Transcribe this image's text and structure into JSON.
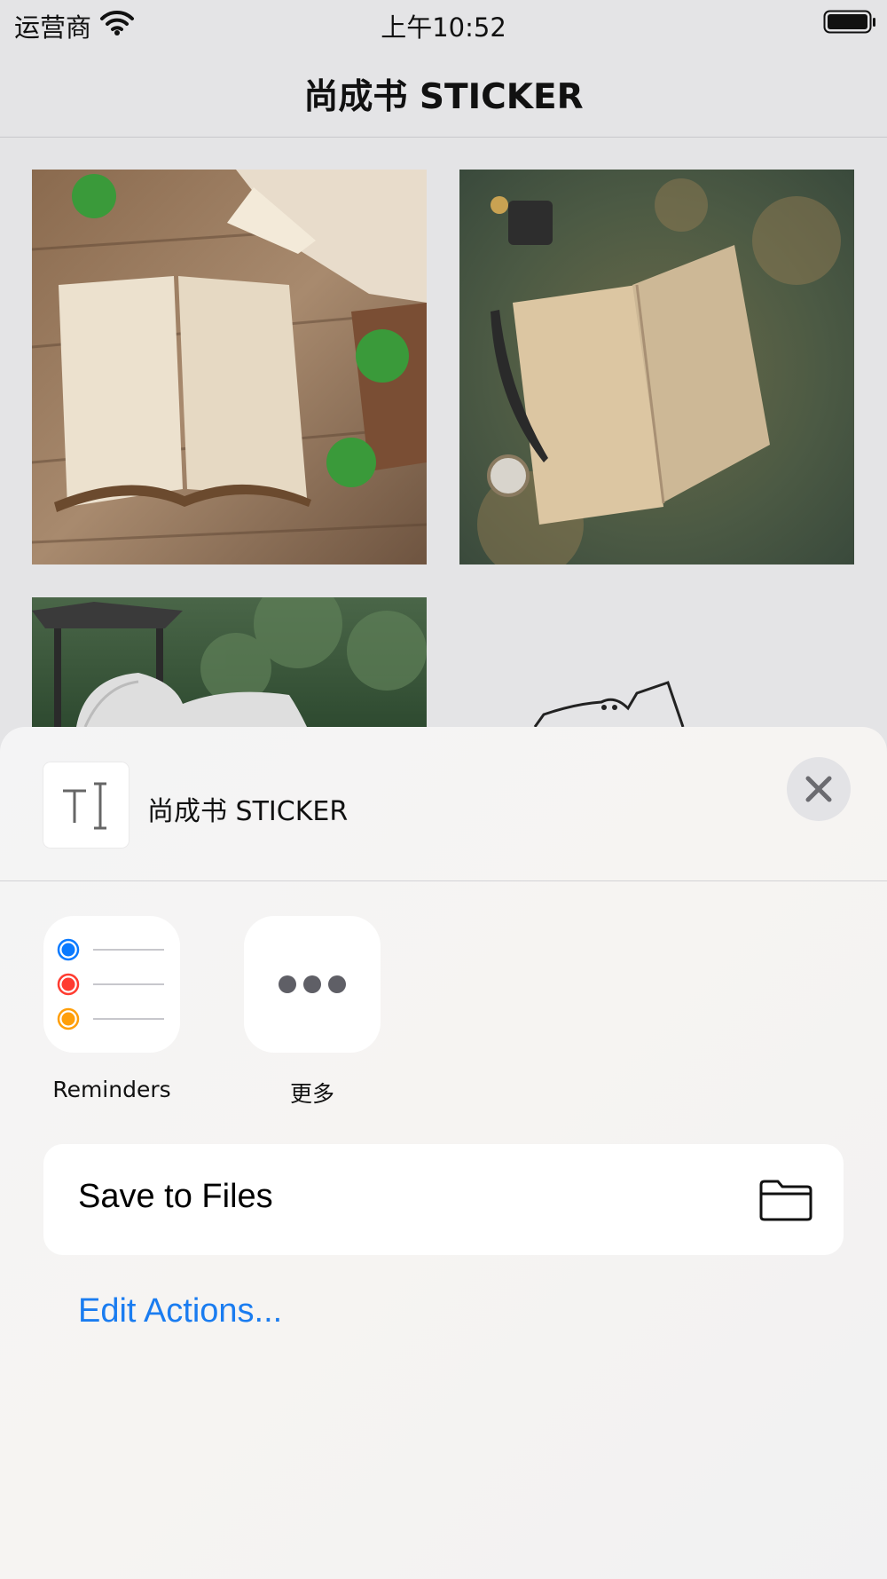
{
  "status_bar": {
    "carrier": "运营商",
    "time": "上午10:52"
  },
  "nav": {
    "title": "尚成书 STICKER"
  },
  "grid": {
    "items": [
      "open-book-leaves",
      "open-book-quill",
      "garden-bench",
      "sticker-drawing"
    ]
  },
  "share_sheet": {
    "title": "尚成书 STICKER",
    "apps": [
      {
        "label": "Reminders",
        "icon": "reminders-icon"
      },
      {
        "label": "更多",
        "icon": "more-icon"
      }
    ],
    "actions": [
      {
        "label": "Save to Files",
        "icon": "folder-icon"
      }
    ],
    "edit_actions_label": "Edit Actions...",
    "colors": {
      "link": "#1a7cf0",
      "reminder_blue": "#0a7aff",
      "reminder_red": "#ff3b30",
      "reminder_orange": "#ff9f0a"
    }
  }
}
